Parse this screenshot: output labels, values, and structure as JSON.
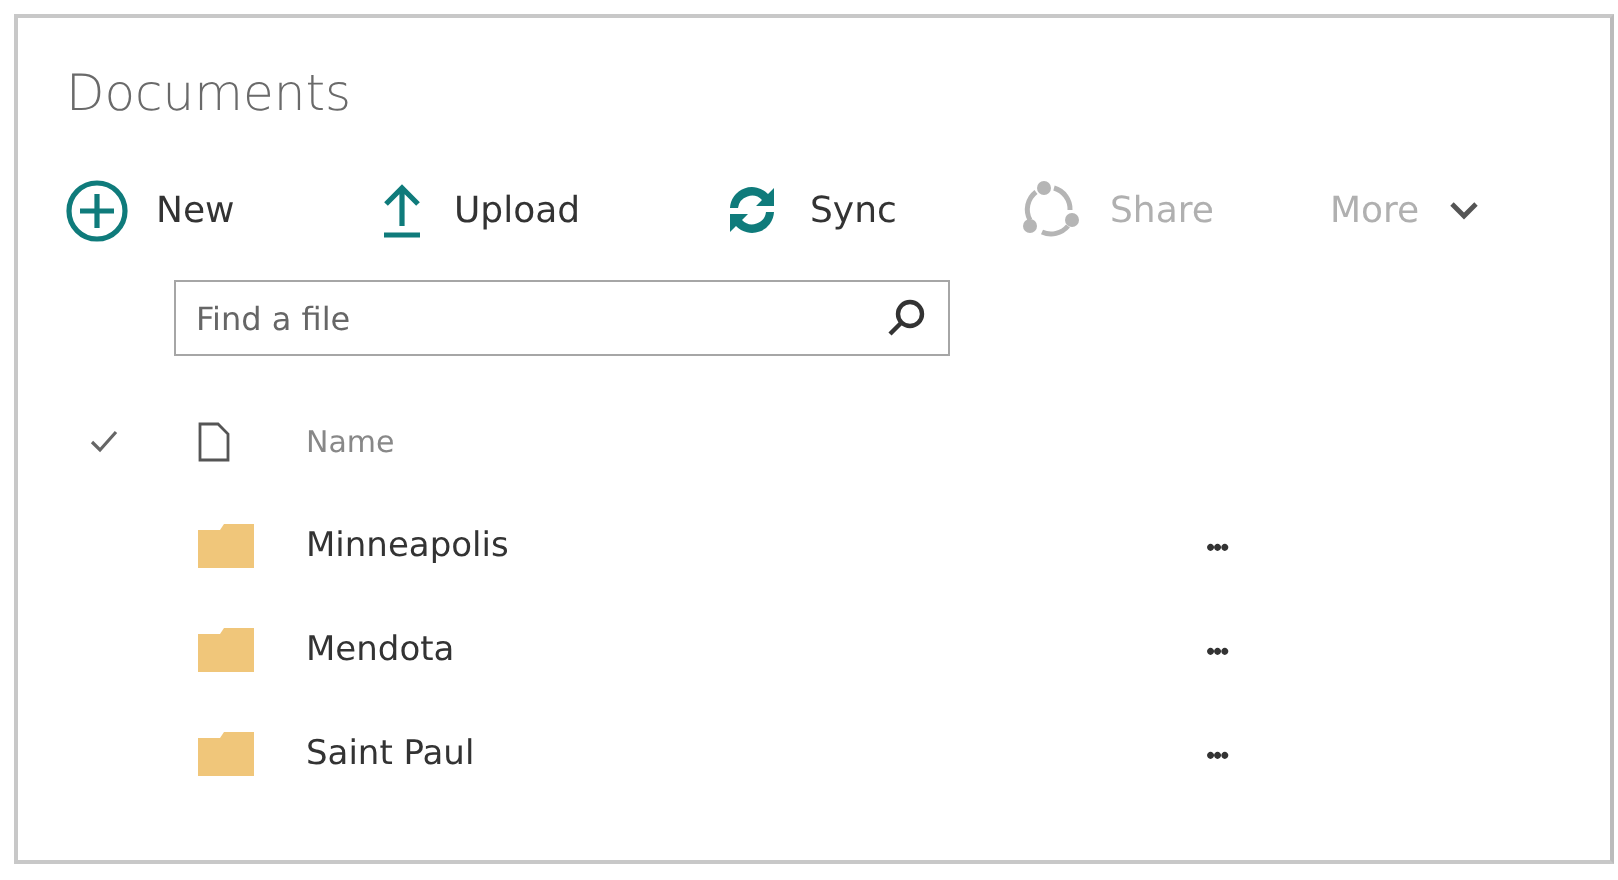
{
  "title": "Documents",
  "toolbar": [
    {
      "kind": "new",
      "label": "New",
      "disabled": false
    },
    {
      "kind": "upload",
      "label": "Upload",
      "disabled": false
    },
    {
      "kind": "sync",
      "label": "Sync",
      "disabled": false
    },
    {
      "kind": "share",
      "label": "Share",
      "disabled": true
    },
    {
      "kind": "more",
      "label": "More",
      "disabled": true
    }
  ],
  "search": {
    "placeholder": "Find a file"
  },
  "table": {
    "columns": [
      "Name"
    ],
    "rows": [
      {
        "name": "Minneapolis",
        "actions": "•••"
      },
      {
        "name": "Mendota",
        "actions": "•••"
      },
      {
        "name": "Saint Paul",
        "actions": "•••"
      }
    ]
  }
}
